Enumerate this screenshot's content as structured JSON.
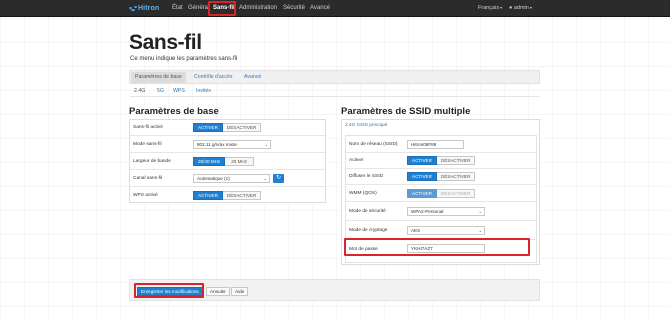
{
  "navbar": {
    "brand": "Hitron",
    "items": [
      "État",
      "Général",
      "Sans-fil",
      "Administration",
      "Sécurité",
      "Avancé"
    ],
    "active_item": "Sans-fil",
    "language": "Français",
    "user": "admin"
  },
  "page": {
    "title": "Sans-fil",
    "subtitle": "Ce menu indique les paramètres sans-fil"
  },
  "tabs": [
    "Paramètres de base",
    "Contrôle d'accès",
    "Avancé"
  ],
  "subtabs": [
    "2.4G",
    "5G",
    "WPS",
    "Invités"
  ],
  "basic": {
    "title": "Paramètres de base",
    "rows": {
      "enabled_label": "Sans-fil activé",
      "mode_label": "Mode sans-fil",
      "mode_value": "802.11 g/n/ax mixte",
      "bandwidth_label": "Largeur de bande",
      "bw_on": "20/40 MHz",
      "bw_off": "20 MHz",
      "channel_label": "Canal sans-fil",
      "channel_value": "Automatique (1)",
      "wps_label": "WPS activé"
    },
    "on_label": "ACTIVER",
    "off_label": "DÉSACTIVER"
  },
  "ssid": {
    "title": "Paramètres de SSID multiple",
    "panel_head": "2.4G SSID principal",
    "name_label": "Nom de réseau (SSID)",
    "name_value": "Hitron08F88",
    "enable_label": "Activer",
    "broadcast_label": "Diffuser le SSID",
    "wmm_label": "WMM (QOS)",
    "security_label": "Mode de sécurité",
    "security_value": "WPA2-Personal",
    "encryption_label": "Mode de cryptage",
    "encryption_value": "AES",
    "password_label": "Mot de passe",
    "password_value": "YKHI7AZ7"
  },
  "footer": {
    "save": "Enregistrer les modifications",
    "cancel": "Annuler",
    "help": "Aide"
  },
  "colors": {
    "accent": "#1f7fd1",
    "highlight": "#d9232d",
    "navbar": "#2b2b2b"
  }
}
